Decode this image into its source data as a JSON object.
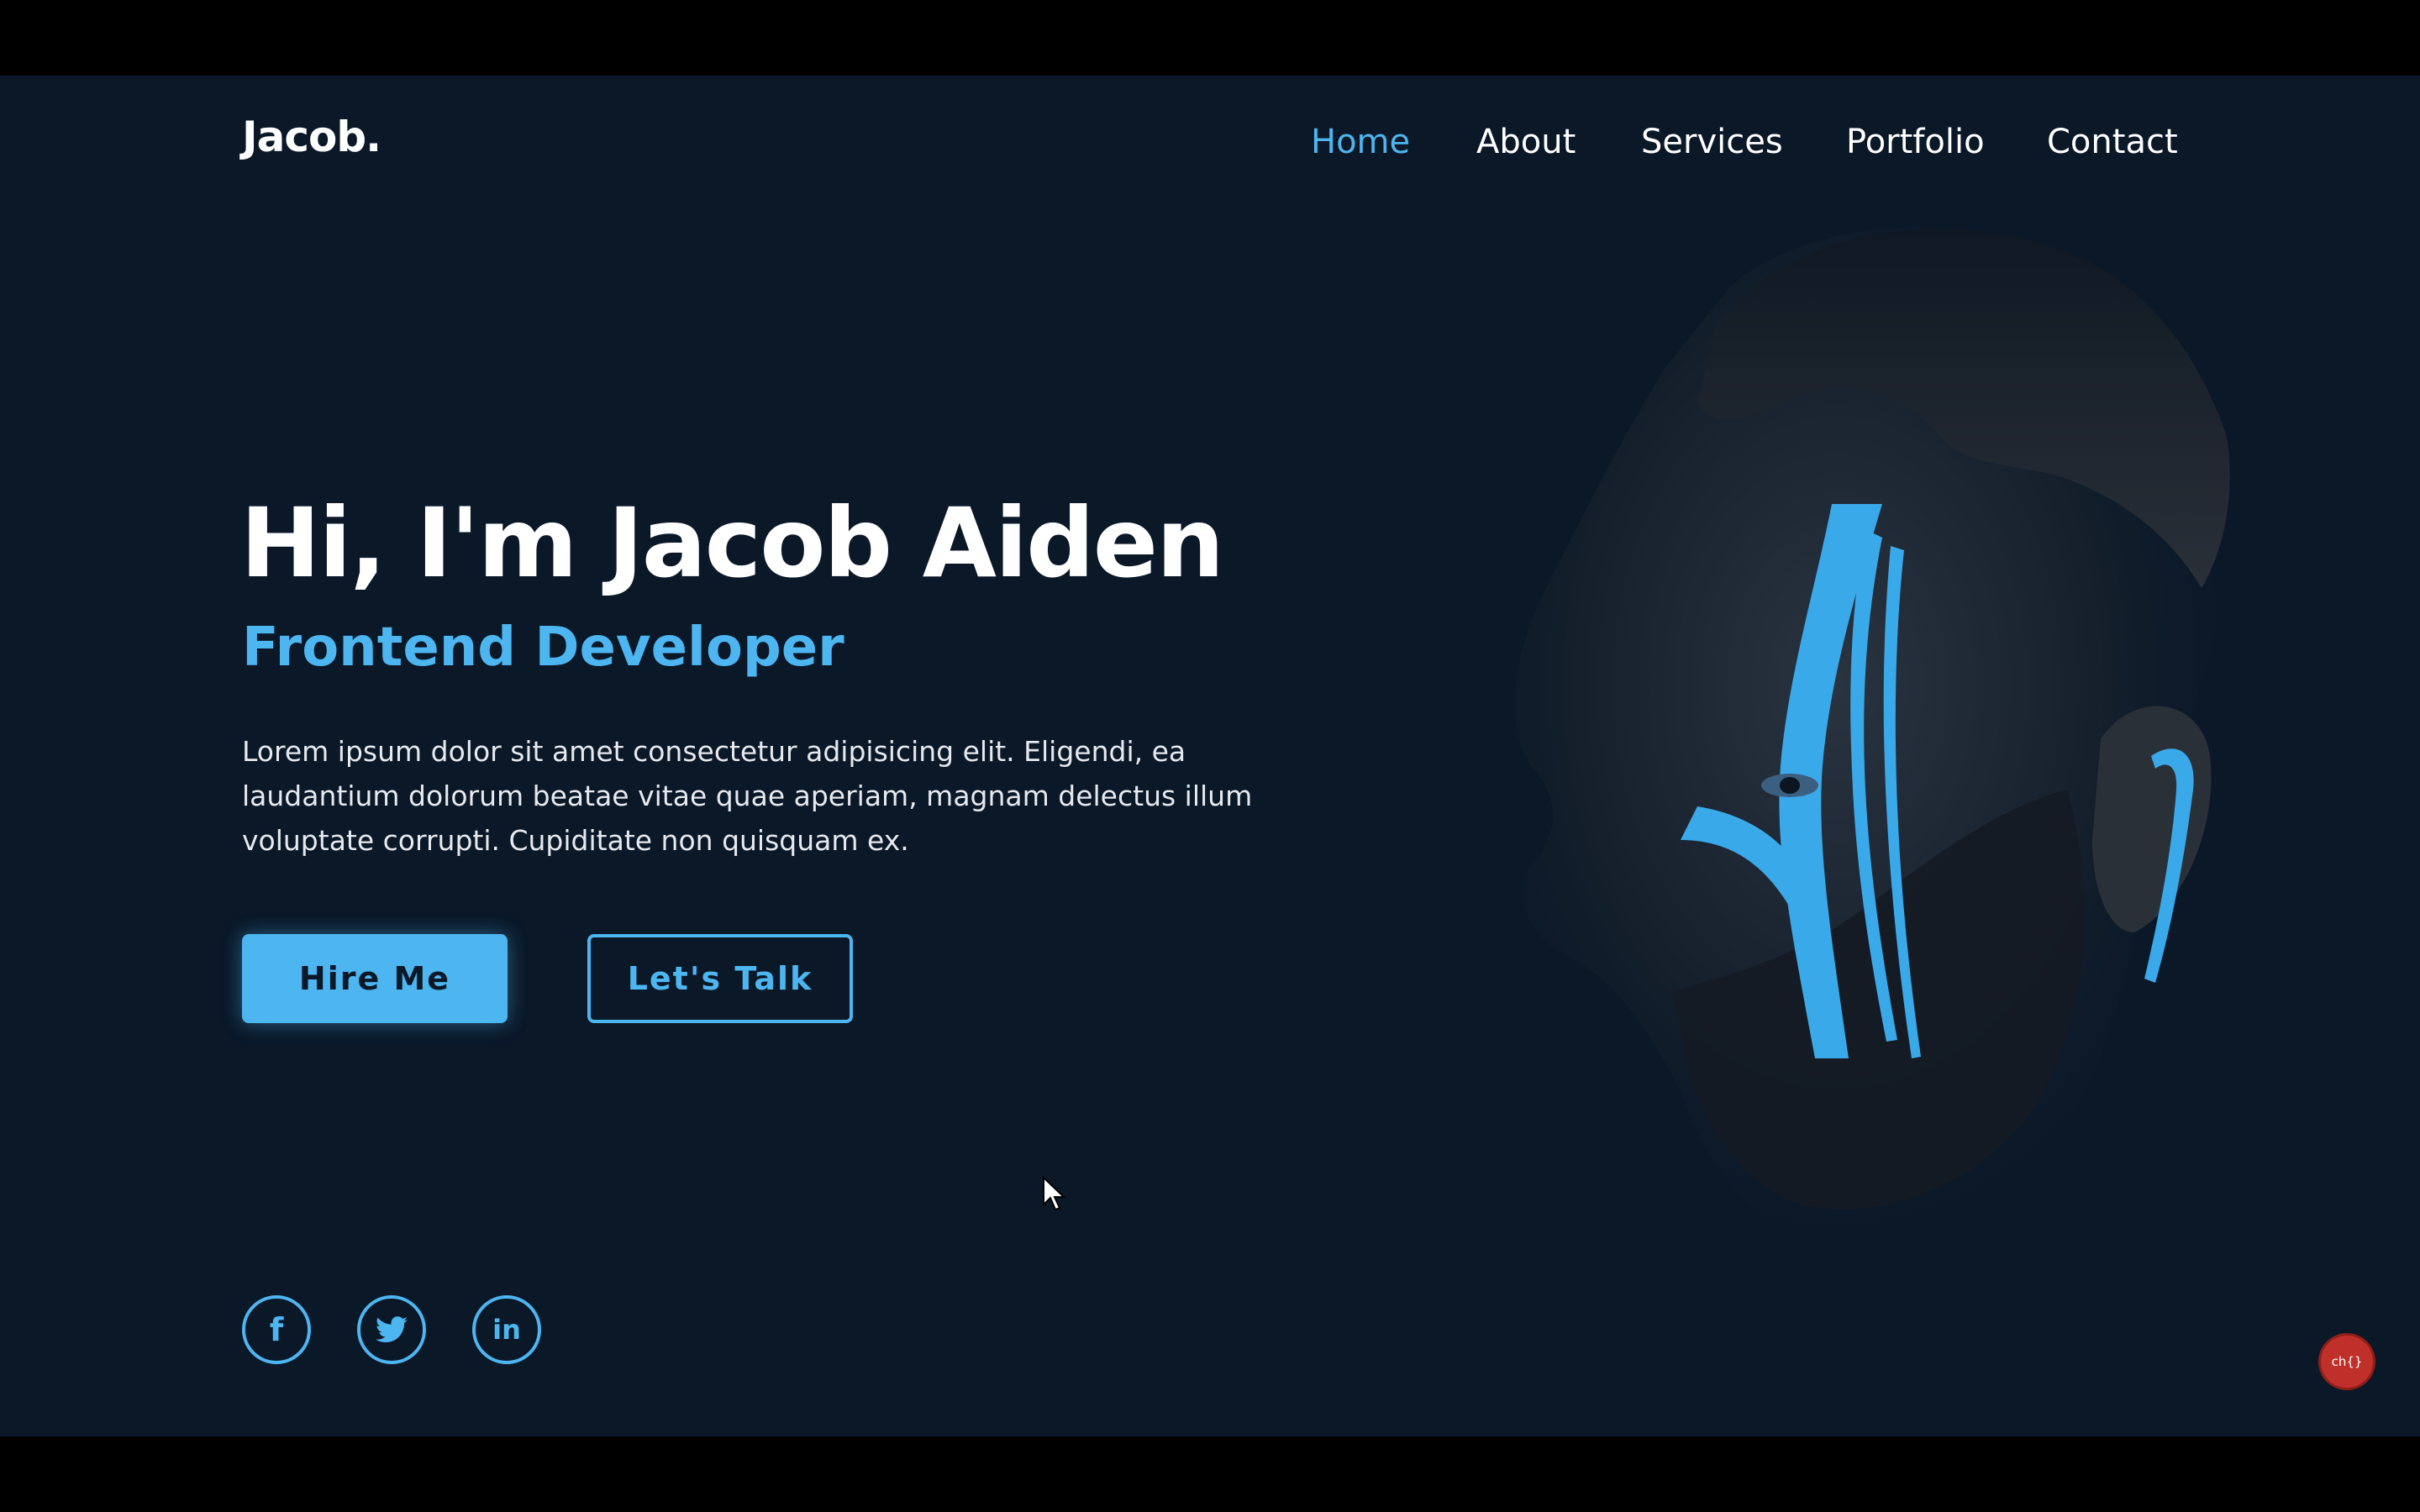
{
  "brand": {
    "logo": "Jacob."
  },
  "nav": {
    "items": [
      {
        "label": "Home",
        "active": true
      },
      {
        "label": "About",
        "active": false
      },
      {
        "label": "Services",
        "active": false
      },
      {
        "label": "Portfolio",
        "active": false
      },
      {
        "label": "Contact",
        "active": false
      }
    ]
  },
  "hero": {
    "title": "Hi, I'm Jacob Aiden",
    "subtitle": "Frontend Developer",
    "description": "Lorem ipsum dolor sit amet consectetur adipisicing elit. Eligendi, ea laudantium dolorum beatae vitae quae aperiam, magnam delectus illum voluptate corrupti. Cupiditate non quisquam ex.",
    "primary_button": "Hire Me",
    "secondary_button": "Let's Talk"
  },
  "social": {
    "icons": [
      "facebook-icon",
      "twitter-icon",
      "linkedin-icon"
    ]
  },
  "colors": {
    "background": "#0a1828",
    "accent": "#4db5f0",
    "text": "#ffffff"
  }
}
